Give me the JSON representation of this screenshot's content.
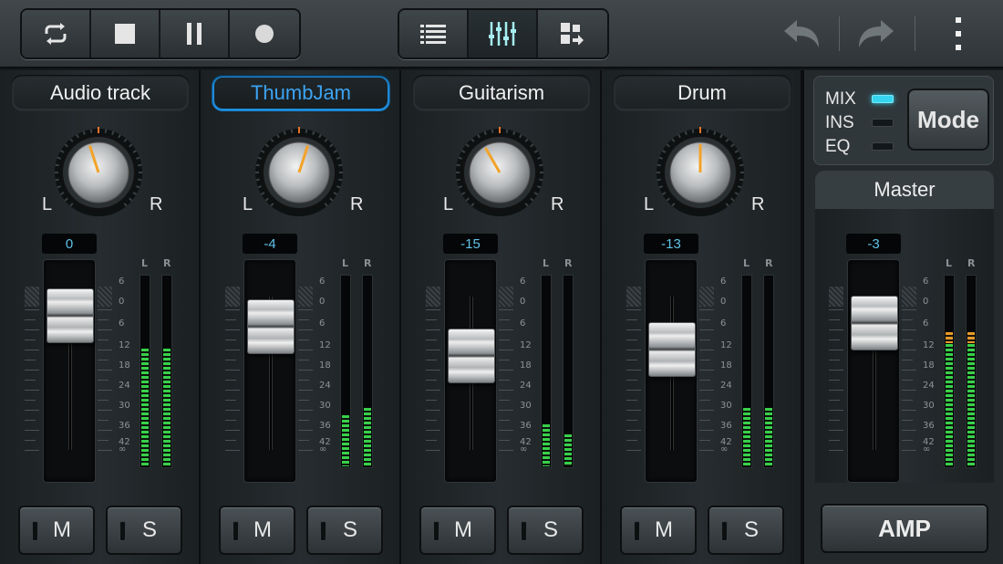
{
  "toolbar": {
    "transport": [
      {
        "name": "loop",
        "icon": "loop-icon"
      },
      {
        "name": "stop",
        "icon": "stop-icon"
      },
      {
        "name": "pause",
        "icon": "pause-icon"
      },
      {
        "name": "record",
        "icon": "record-icon"
      }
    ],
    "views": [
      {
        "name": "track-list",
        "icon": "list-icon",
        "active": false
      },
      {
        "name": "mixer",
        "icon": "mixer-sliders-icon",
        "active": true
      },
      {
        "name": "apps",
        "icon": "grid-export-icon",
        "active": false
      }
    ],
    "undo_icon": "undo-icon",
    "redo_icon": "redo-icon",
    "menu_icon": "more-vert-icon"
  },
  "channels": [
    {
      "name": "Audio track",
      "selected": false,
      "pan_label_left": "L",
      "pan_label_right": "R",
      "volume": "0",
      "fader_level": 0.89,
      "meter_left": 0.62,
      "meter_right": 0.62,
      "mute": "M",
      "solo": "S"
    },
    {
      "name": "ThumbJam",
      "selected": true,
      "pan_label_left": "L",
      "pan_label_right": "R",
      "volume": "-4",
      "fader_level": 0.82,
      "meter_left": 0.27,
      "meter_right": 0.31,
      "mute": "M",
      "solo": "S"
    },
    {
      "name": "Guitarism",
      "selected": false,
      "pan_label_left": "L",
      "pan_label_right": "R",
      "volume": "-15",
      "fader_level": 0.63,
      "meter_left": 0.22,
      "meter_right": 0.17,
      "mute": "M",
      "solo": "S"
    },
    {
      "name": "Drum",
      "selected": false,
      "pan_label_left": "L",
      "pan_label_right": "R",
      "volume": "-13",
      "fader_level": 0.67,
      "meter_left": 0.31,
      "meter_right": 0.31,
      "mute": "M",
      "solo": "S"
    }
  ],
  "meter_header": {
    "left": "L",
    "right": "R"
  },
  "scale": [
    "6",
    "0",
    "6",
    "12",
    "18",
    "24",
    "30",
    "36",
    "42",
    "∞"
  ],
  "mode_panel": {
    "options": [
      {
        "label": "MIX",
        "on": true
      },
      {
        "label": "INS",
        "on": false
      },
      {
        "label": "EQ",
        "on": false
      }
    ],
    "mode_button": "Mode"
  },
  "master": {
    "title": "Master",
    "volume": "-3",
    "fader_level": 0.84,
    "meter_left": 0.72,
    "meter_right": 0.72,
    "amp_button": "AMP"
  },
  "colors": {
    "accent": "#3da3f2",
    "value_text": "#5fc3e8",
    "meter_green": "#39d04a",
    "led_on": "#37d6f0"
  }
}
